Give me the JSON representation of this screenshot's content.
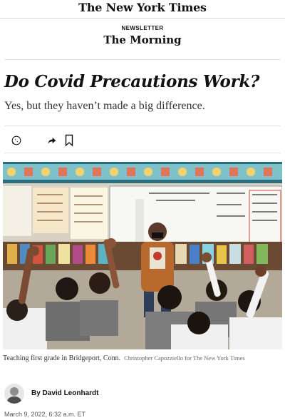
{
  "masthead": {
    "logo": "The New York Times"
  },
  "newsletter": {
    "label": "NEWSLETTER",
    "name": "The Morning"
  },
  "article": {
    "headline": "Do Covid Precautions Work?",
    "dek": "Yes, but they haven’t made a big difference."
  },
  "share": {
    "icons": [
      "whatsapp-icon",
      "share-arrow-icon",
      "bookmark-icon"
    ]
  },
  "photo": {
    "board_text": "Today is Wednesday, February 23, 2022",
    "caption": "Teaching first grade in Bridgeport, Conn.",
    "credit": "Christopher Capozziello for The New York Times"
  },
  "author": {
    "byline": "By David Leonhardt"
  },
  "date": "March 9, 2022, 6:32 a.m. ET",
  "colors": {
    "text": "#121212",
    "rule": "#e2e2e2",
    "whatsapp": "#121212"
  }
}
